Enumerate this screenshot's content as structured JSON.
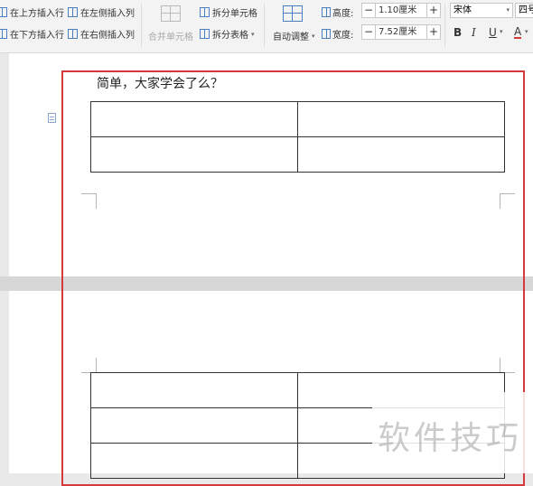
{
  "ribbon": {
    "insert_above": "在上方插入行",
    "insert_below": "在下方插入行",
    "insert_left": "在左侧插入列",
    "insert_right": "在右侧插入列",
    "merge_cells": "合并单元格",
    "split_cell": "拆分单元格",
    "split_table": "拆分表格",
    "auto_adjust": "自动调整",
    "height_label": "高度:",
    "height_value": "1.10厘米",
    "width_label": "宽度:",
    "width_value": "7.52厘米",
    "minus": "−",
    "plus": "+",
    "font_name": "宋体",
    "font_size": "四号",
    "bold": "B",
    "italic": "I",
    "underline": "U",
    "font_color": "A"
  },
  "document": {
    "line_text": "简单，大家学会了么？"
  },
  "watermark": "软件技巧",
  "colors": {
    "highlight": "#d6393c",
    "icon_blue": "#4a7fc1",
    "font_color_underline": "#d6393c"
  }
}
